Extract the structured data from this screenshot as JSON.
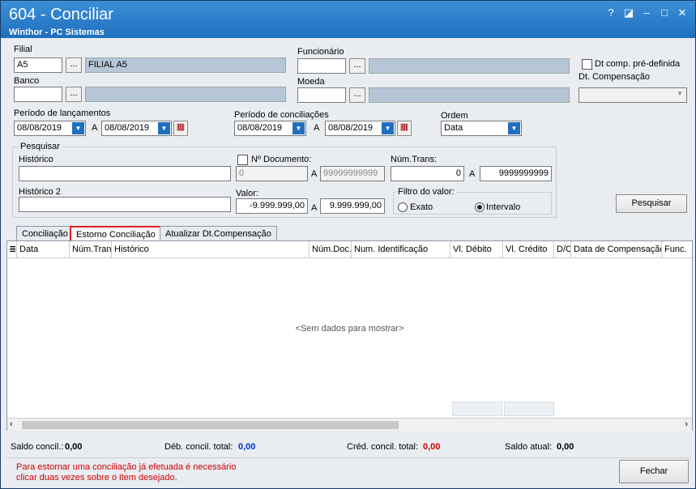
{
  "window": {
    "title": "604 - Conciliar",
    "subtitle": "Winthor - PC Sistemas"
  },
  "filters": {
    "filial_label": "Filial",
    "filial_code": "A5",
    "filial_name": "FILIAL A5",
    "funcionario_label": "Funcionário",
    "banco_label": "Banco",
    "moeda_label": "Moeda",
    "dt_comp_label": "Dt comp. pré-definida",
    "dt_compensacao_label": "Dt. Compensação",
    "periodo_lanc_label": "Período de lançamentos",
    "periodo_lanc_from": "08/08/2019",
    "periodo_lanc_to": "08/08/2019",
    "periodo_conc_label": "Período de conciliações",
    "periodo_conc_from": "08/08/2019",
    "periodo_conc_to": "08/08/2019",
    "a_label": "A",
    "ordem_label": "Ordem",
    "ordem_value": "Data"
  },
  "search": {
    "group_label": "Pesquisar",
    "historico_label": "Histórico",
    "nro_doc_label": "Nº Documento:",
    "nro_doc_from": "0",
    "nro_doc_to": "99999999999",
    "num_trans_label": "Núm.Trans:",
    "num_trans_from": "0",
    "num_trans_to": "9999999999",
    "historico2_label": "Histórico 2",
    "valor_label": "Valor:",
    "valor_from": "-9.999.999,00",
    "valor_to": "9.999.999,00",
    "filtro_label": "Filtro do valor:",
    "exato_label": "Exato",
    "intervalo_label": "Intervalo",
    "pesquisar_button": "Pesquisar"
  },
  "tabs": [
    {
      "label": "Conciliação"
    },
    {
      "label": "Estorno Conciliação"
    },
    {
      "label": "Atualizar Dt.Compensação"
    }
  ],
  "grid": {
    "columns": [
      "Data",
      "Núm.Tran",
      "Histórico",
      "Núm.Doc.",
      "Num. Identificação",
      "Vl. Débito",
      "Vl. Crédito",
      "D/C",
      "Data de Compensação",
      "Func."
    ],
    "empty_text": "<Sem dados para mostrar>"
  },
  "totals": {
    "saldo_concil_label": "Saldo concil.:",
    "saldo_concil_value": "0,00",
    "deb_label": "Déb. concil. total:",
    "deb_value": "0,00",
    "cred_label": "Créd. concil. total:",
    "cred_value": "0,00",
    "saldo_atual_label": "Saldo atual:",
    "saldo_atual_value": "0,00"
  },
  "footer": {
    "message_line1": "Para estornar uma conciliação já efetuada é necessário",
    "message_line2": "clicar duas vezes sobre o item desejado.",
    "fechar_button": "Fechar"
  }
}
